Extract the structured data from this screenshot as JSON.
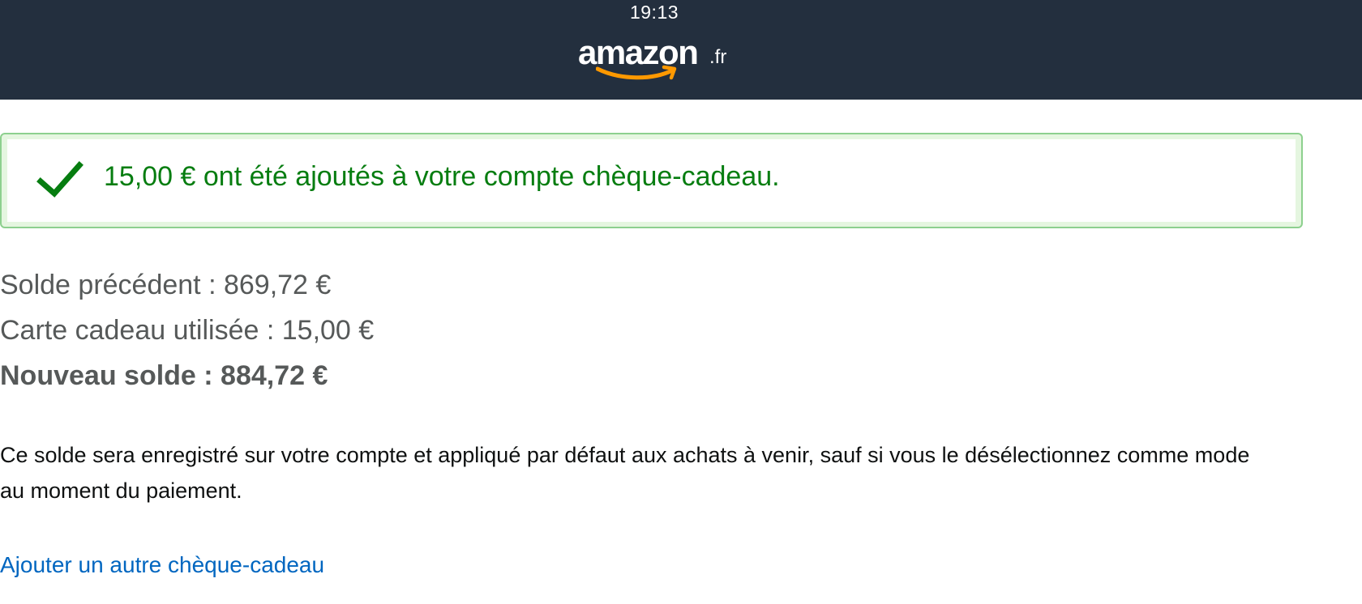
{
  "status_bar": {
    "time": "19:13"
  },
  "header": {
    "logo_word": "amazon",
    "logo_tld": ".fr",
    "background_color": "#232f3e",
    "smile_color": "#ff9900"
  },
  "alert": {
    "icon": "checkmark-icon",
    "message": "15,00 € ont été ajoutés à votre compte chèque-cadeau.",
    "text_color": "#067d10"
  },
  "balance": {
    "previous": "Solde précédent : 869,72 €",
    "card_used": "Carte cadeau utilisée : 15,00 €",
    "new_balance": "Nouveau solde : 884,72 €"
  },
  "info": {
    "text": "Ce solde sera enregistré sur votre compte et appliqué par défaut aux achats à venir, sauf si vous le désélectionnez comme mode au moment du paiement."
  },
  "actions": {
    "add_another_label": "Ajouter un autre chèque-cadeau",
    "link_color": "#0066c0"
  }
}
